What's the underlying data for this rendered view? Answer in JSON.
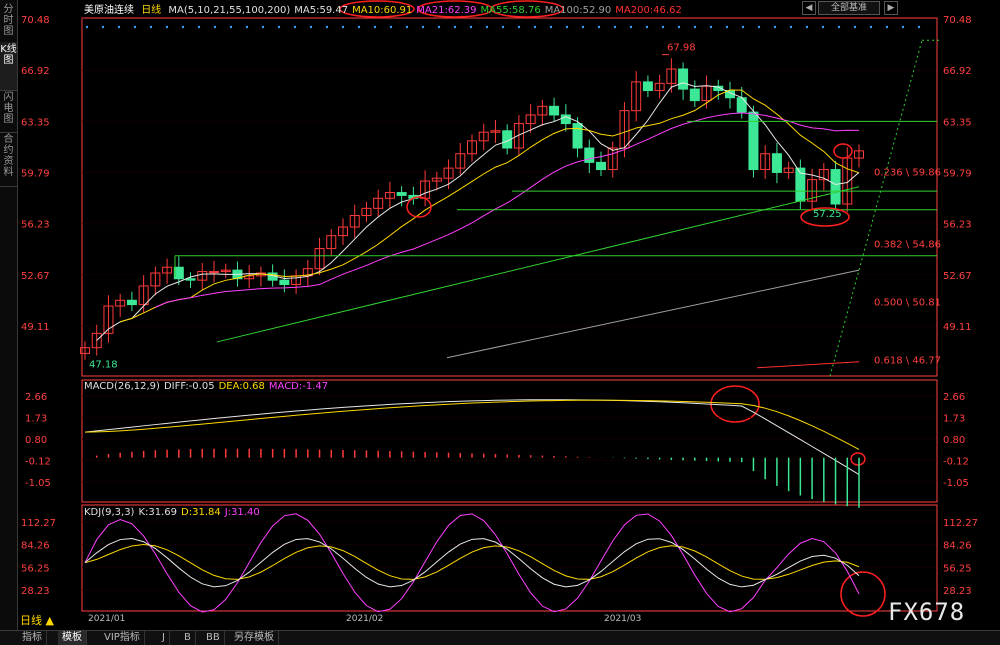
{
  "sidebar": {
    "tabs": [
      {
        "label": "分时图",
        "active": false
      },
      {
        "label": "K线图",
        "active": true
      },
      {
        "label": "闪电图",
        "active": false
      },
      {
        "label": "合约资料",
        "active": false
      }
    ]
  },
  "header": {
    "instrument": "美原油连续",
    "period": "日线",
    "ma_legend": [
      {
        "text": "MA(5,10,21,55,100,200)",
        "color": "#e0e0e0"
      },
      {
        "text": "MA5:59.47",
        "color": "#e0e0e0"
      },
      {
        "text": "MA10:60.91",
        "color": "#ffd800"
      },
      {
        "text": "MA21:62.39",
        "color": "#ff40ff"
      },
      {
        "text": "MA55:58.76",
        "color": "#30d030"
      },
      {
        "text": "MA100:52.90",
        "color": "#a0a0a0"
      },
      {
        "text": "MA200:46.62",
        "color": "#ff3030"
      }
    ],
    "all_params": "全部基准",
    "nav_left": "◀",
    "nav_right": "▶"
  },
  "colors": {
    "up": "#ff3a3a",
    "down": "#3ce896",
    "axis": "#ff4040",
    "grid": "#3a0000"
  },
  "price_axis": [
    70.48,
    66.92,
    63.35,
    59.79,
    56.23,
    52.67,
    49.11
  ],
  "price_labels": {
    "high": "67.98",
    "low": "47.18",
    "recent_low": "57.25"
  },
  "fib": [
    {
      "text": "0.236 \\ 59.86",
      "price": 59.86
    },
    {
      "text": "0.382 \\ 54.86",
      "price": 54.86
    },
    {
      "text": "0.500 \\ 50.81",
      "price": 50.81
    },
    {
      "text": "0.618 \\ 46.77",
      "price": 46.77
    }
  ],
  "macd": {
    "legend": [
      {
        "text": "MACD(26,12,9)",
        "color": "#e0e0e0"
      },
      {
        "text": "DIFF:-0.05",
        "color": "#e0e0e0"
      },
      {
        "text": "DEA:0.68",
        "color": "#ffd800"
      },
      {
        "text": "MACD:-1.47",
        "color": "#ff40ff"
      }
    ],
    "axis": [
      2.66,
      1.73,
      0.8,
      -0.12,
      -1.05
    ]
  },
  "kdj": {
    "legend": [
      {
        "text": "KDJ(9,3,3)",
        "color": "#e0e0e0"
      },
      {
        "text": "K:31.69",
        "color": "#e0e0e0"
      },
      {
        "text": "D:31.84",
        "color": "#ffd800"
      },
      {
        "text": "J:31.40",
        "color": "#ff40ff"
      }
    ],
    "axis": [
      112.27,
      84.26,
      56.25,
      28.23
    ]
  },
  "dates": [
    "2021/01",
    "2021/02",
    "2021/03"
  ],
  "period_button": "日线 ▲",
  "bottom_tabs": [
    {
      "label": "指标",
      "active": false
    },
    {
      "label": "模板",
      "active": true
    },
    {
      "label": "VIP指标",
      "active": false
    },
    {
      "label": "J",
      "active": false
    },
    {
      "label": "B",
      "active": false
    },
    {
      "label": "BB",
      "active": false
    },
    {
      "label": "另存模板",
      "active": false
    }
  ],
  "watermark": "FX678",
  "chart_data": {
    "type": "candlestick",
    "closes": [
      47.6,
      48.6,
      50.5,
      50.9,
      50.6,
      51.9,
      52.8,
      53.2,
      52.4,
      52.3,
      52.9,
      52.9,
      53.0,
      52.4,
      52.6,
      52.8,
      52.3,
      52.0,
      52.6,
      53.1,
      54.5,
      55.4,
      56.0,
      56.8,
      57.3,
      58.0,
      58.4,
      58.2,
      58.0,
      59.2,
      59.4,
      60.1,
      61.1,
      62.0,
      62.6,
      62.7,
      61.5,
      63.2,
      63.8,
      64.4,
      63.8,
      63.2,
      61.5,
      60.5,
      60.0,
      61.5,
      64.1,
      66.1,
      65.5,
      66.0,
      67.0,
      65.6,
      64.8,
      65.8,
      65.5,
      65.0,
      64.0,
      60.0,
      61.1,
      59.8,
      60.1,
      57.8,
      59.3,
      60.0,
      57.6,
      60.8,
      61.3
    ]
  }
}
